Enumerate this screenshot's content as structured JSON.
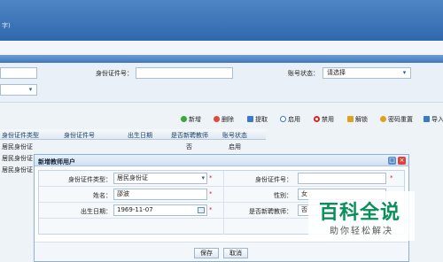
{
  "header": {
    "hint": "字)"
  },
  "search": {
    "id_number_label": "身份证件号：",
    "account_status_label": "账号状态：",
    "account_status_value": "请选择"
  },
  "toolbar": {
    "buttons": [
      {
        "label": "新增",
        "color": "#3aa83a"
      },
      {
        "label": "删除",
        "color": "#e04a3a"
      },
      {
        "label": "提取",
        "color": "#3a7ac8"
      },
      {
        "label": "启用",
        "color": "#3a7ac8"
      },
      {
        "label": "禁用",
        "color": "#d22"
      },
      {
        "label": "解锁",
        "color": "#e0a020"
      },
      {
        "label": "密码重置",
        "color": "#e0a020"
      },
      {
        "label": "导入",
        "color": "#3a7ac8"
      }
    ]
  },
  "grid": {
    "headers": [
      "身份证件类型",
      "身份证件号",
      "出生日期",
      "是否新聘教师",
      "账号状态"
    ],
    "rows": [
      {
        "id_type": "居民身份证",
        "new_teacher": "否",
        "status": "启用"
      },
      {
        "id_type": "居民身份证"
      },
      {
        "id_type": "居民身份证"
      }
    ]
  },
  "dialog": {
    "title": "新增教师用户",
    "fields": {
      "id_type_label": "身份证件类型：",
      "id_type_value": "居民身份证",
      "id_number_label": "身份证件号：",
      "id_number_value": "",
      "name_label": "姓名：",
      "name_value": "邵波",
      "gender_label": "性别：",
      "gender_value": "女",
      "birth_label": "出生日期：",
      "birth_value": "1969-11-07",
      "new_teacher_label": "是否新聘教师：",
      "new_teacher_value": "否"
    },
    "required_mark": "*",
    "save_label": "保存",
    "cancel_label": "取消"
  },
  "watermark": {
    "title": "百科全说",
    "subtitle": "助你轻松解决"
  }
}
